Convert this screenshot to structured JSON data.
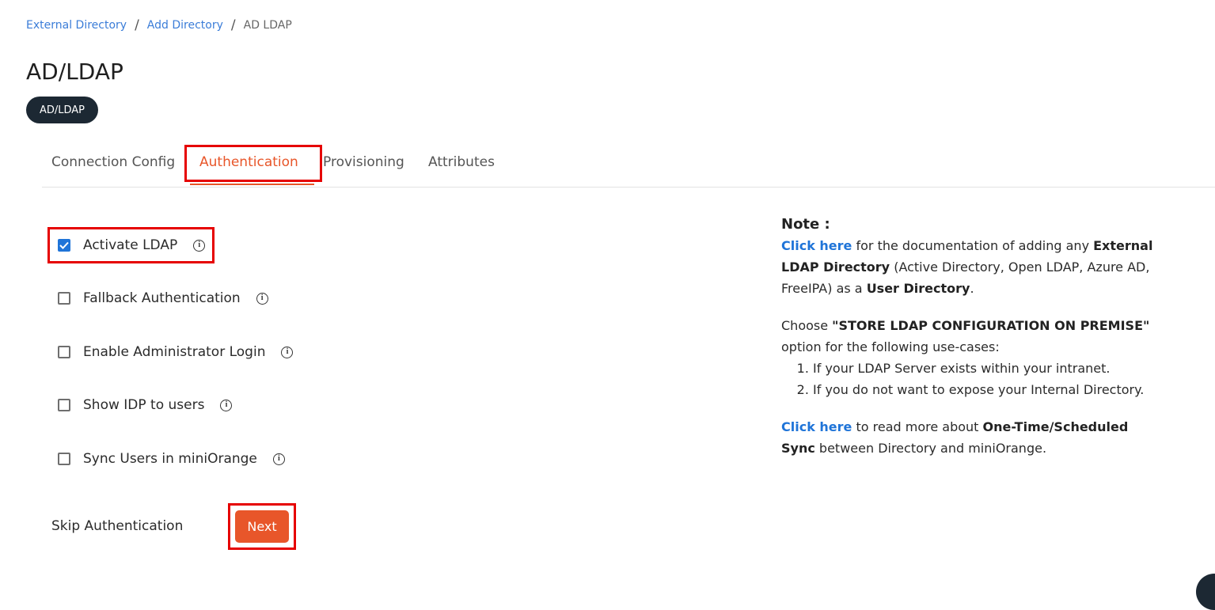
{
  "breadcrumb": {
    "items": [
      "External Directory",
      "Add Directory"
    ],
    "current": "AD LDAP",
    "separator": "/"
  },
  "page": {
    "title": "AD/LDAP",
    "badge": "AD/LDAP"
  },
  "tabs": [
    {
      "label": "Connection Config",
      "active": false
    },
    {
      "label": "Authentication",
      "active": true
    },
    {
      "label": "Provisioning",
      "active": false
    },
    {
      "label": "Attributes",
      "active": false
    }
  ],
  "options": [
    {
      "label": "Activate LDAP",
      "checked": true
    },
    {
      "label": "Fallback Authentication",
      "checked": false
    },
    {
      "label": "Enable Administrator Login",
      "checked": false
    },
    {
      "label": "Show IDP to users",
      "checked": false
    },
    {
      "label": "Sync Users in miniOrange",
      "checked": false
    }
  ],
  "actions": {
    "skip_label": "Skip Authentication",
    "next_label": "Next"
  },
  "note": {
    "heading": "Note :",
    "p1": {
      "link": "Click here",
      "t1": " for the documentation of adding any ",
      "b1": "External LDAP Directory",
      "t2": " (Active Directory, Open LDAP, Azure AD, FreeIPA) as a ",
      "b2": "User Directory",
      "t3": "."
    },
    "p2": {
      "t1": "Choose ",
      "b1": "\"STORE LDAP CONFIGURATION ON PREMISE\"",
      "t2": " option for the following use-cases:"
    },
    "list": [
      "If your LDAP Server exists within your intranet.",
      "If you do not want to expose your Internal Directory."
    ],
    "p3": {
      "link": "Click here",
      "t1": " to read more about ",
      "b1": "One-Time/Scheduled Sync",
      "t2": " between Directory and miniOrange."
    }
  },
  "colors": {
    "accent": "#e8562a",
    "link": "#3b7dd8",
    "checkbox_checked": "#1f74d8",
    "highlight": "#e60000",
    "badge_bg": "#1c2833"
  }
}
